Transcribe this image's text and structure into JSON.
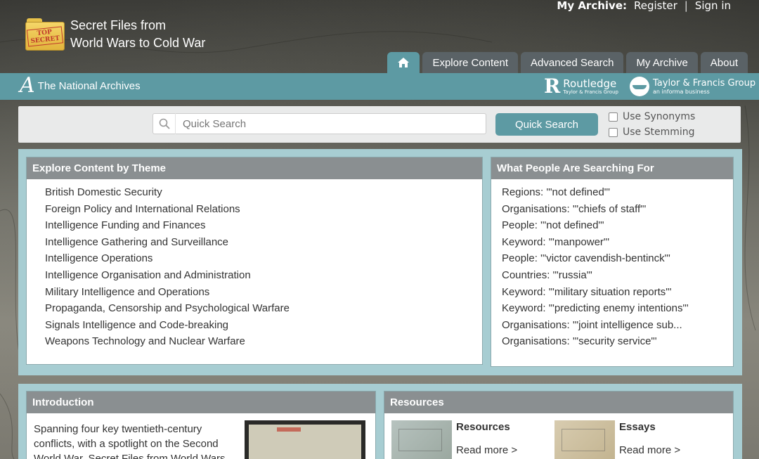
{
  "top_links": {
    "my_archive_label": "My Archive:",
    "register": "Register",
    "separator": "|",
    "sign_in": "Sign in"
  },
  "logo": {
    "stamp_line1": "TOP",
    "stamp_line2": "SECRET",
    "title_line1": "Secret Files from",
    "title_line2": "World Wars to Cold War"
  },
  "nav": {
    "home_icon": "home-icon",
    "tabs": [
      "Explore Content",
      "Advanced Search",
      "My Archive",
      "About"
    ]
  },
  "partners": {
    "tna_mark": "A",
    "tna_name": "The National Archives",
    "routledge_mark": "R",
    "routledge_name": "Routledge",
    "routledge_sub": "Taylor & Francis Group",
    "tf_name": "Taylor & Francis Group",
    "tf_sub": "an informa business"
  },
  "search": {
    "placeholder": "Quick Search",
    "button": "Quick Search",
    "options": [
      "Use Synonyms",
      "Use Stemming"
    ]
  },
  "themes": {
    "heading": "Explore Content by Theme",
    "items": [
      "British Domestic Security",
      "Foreign Policy and International Relations",
      "Intelligence Funding and Finances",
      "Intelligence Gathering and Surveillance",
      "Intelligence Operations",
      "Intelligence Organisation and Administration",
      "Military Intelligence and Operations",
      "Propaganda, Censorship and Psychological Warfare",
      "Signals Intelligence and Code-breaking",
      "Weapons Technology and Nuclear Warfare"
    ]
  },
  "searching": {
    "heading": "What People Are Searching For",
    "items": [
      "Regions: '\"not defined\"'",
      "Organisations: '\"chiefs of staff\"'",
      "People: '\"not defined\"'",
      "Keyword: '\"manpower\"'",
      "People: '\"victor cavendish-bentinck\"'",
      "Countries: '\"russia\"'",
      "Keyword: '\"military situation reports\"'",
      "Keyword: '\"predicting enemy intentions\"'",
      "Organisations: '\"joint intelligence sub...",
      "Organisations: '\"security service\"'"
    ]
  },
  "intro": {
    "heading": "Introduction",
    "text": "Spanning four key twentieth-century conflicts, with a spotlight on the Second World War, Secret Files from World Wars"
  },
  "resources": {
    "heading": "Resources",
    "items": [
      {
        "title": "Resources",
        "link": "Read more >"
      },
      {
        "title": "Essays",
        "link": "Read more >"
      }
    ]
  }
}
